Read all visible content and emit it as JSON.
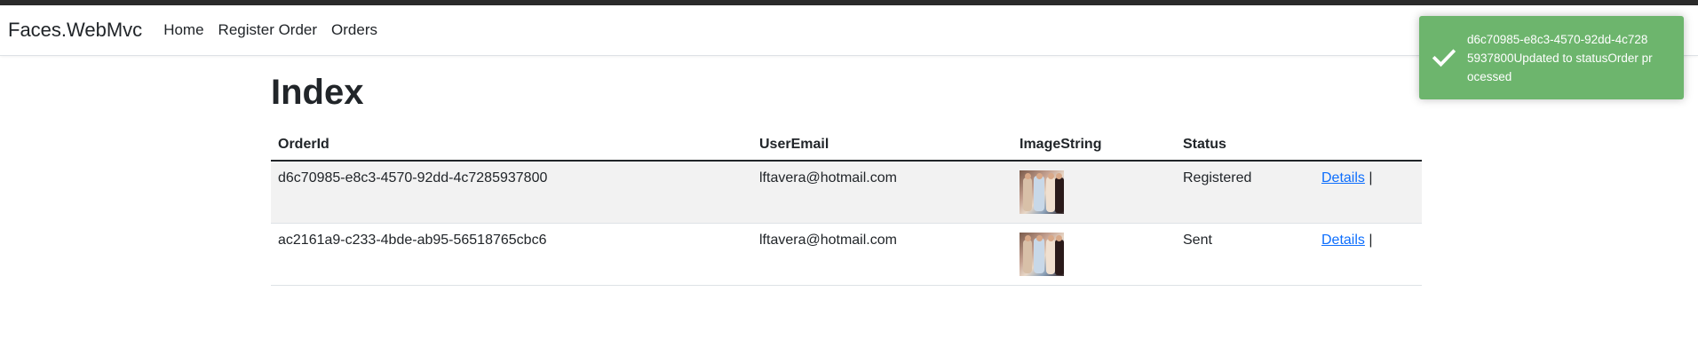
{
  "navbar": {
    "brand": "Faces.WebMvc",
    "links": [
      "Home",
      "Register Order",
      "Orders"
    ]
  },
  "page": {
    "title": "Index"
  },
  "table": {
    "headers": [
      "OrderId",
      "UserEmail",
      "ImageString",
      "Status",
      ""
    ],
    "rows": [
      {
        "order_id": "d6c70985-e8c3-4570-92dd-4c7285937800",
        "user_email": "lftavera@hotmail.com",
        "status": "Registered",
        "details_label": "Details",
        "separator": "|"
      },
      {
        "order_id": "ac2161a9-c233-4bde-ab95-56518765cbc6",
        "user_email": "lftavera@hotmail.com",
        "status": "Sent",
        "details_label": "Details",
        "separator": "|"
      }
    ]
  },
  "toast": {
    "message": "d6c70985-e8c3-4570-92dd-4c7285937800Updated to statusOrder processed",
    "icon": "checkmark-icon",
    "color": "#6db56d"
  },
  "colors": {
    "link": "#0d6efd",
    "row_stripe": "#f2f2f2"
  }
}
